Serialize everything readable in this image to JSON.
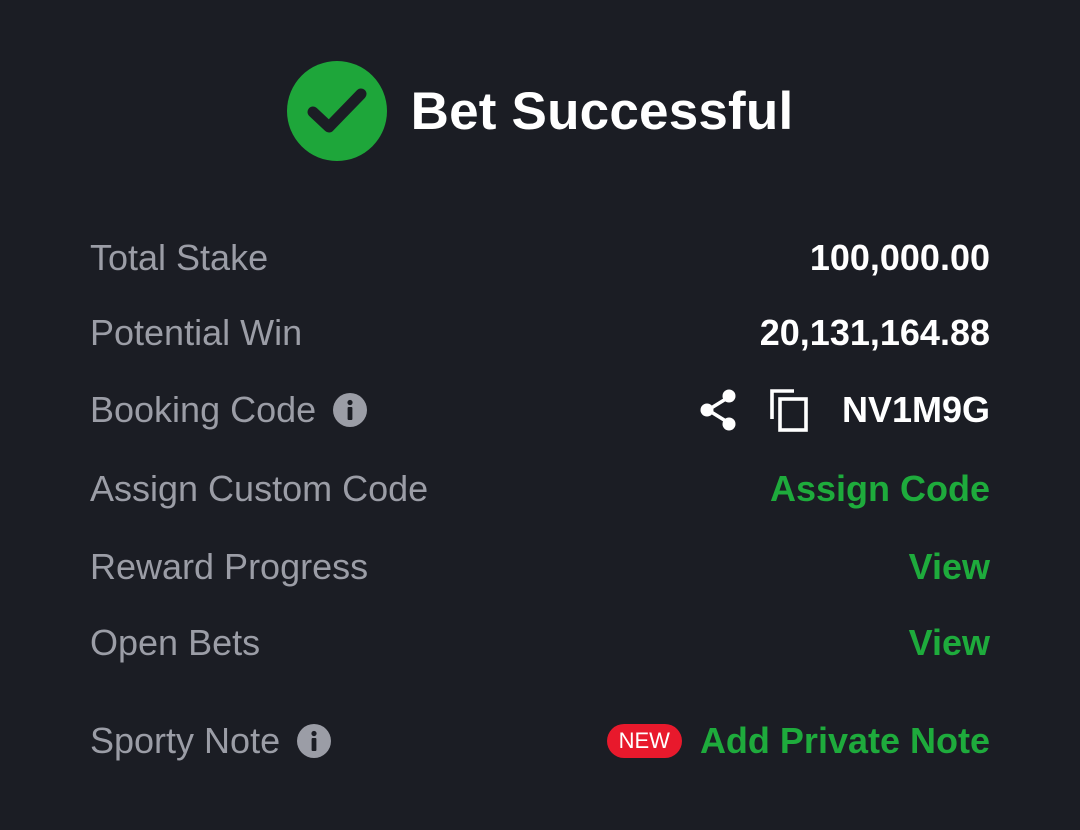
{
  "header": {
    "title": "Bet Successful"
  },
  "rows": {
    "total_stake": {
      "label": "Total Stake",
      "value": "100,000.00"
    },
    "potential_win": {
      "label": "Potential Win",
      "value": "20,131,164.88"
    },
    "booking_code": {
      "label": "Booking Code",
      "value": "NV1M9G"
    },
    "assign_custom_code": {
      "label": "Assign Custom Code",
      "action": "Assign Code"
    },
    "reward_progress": {
      "label": "Reward Progress",
      "action": "View"
    },
    "open_bets": {
      "label": "Open Bets",
      "action": "View"
    },
    "sporty_note": {
      "label": "Sporty Note",
      "badge": "NEW",
      "action": "Add Private Note"
    }
  },
  "icons": {
    "success": "check-circle-icon",
    "info": "info-icon",
    "share": "share-icon",
    "copy": "copy-icon"
  },
  "colors": {
    "background": "#1b1d24",
    "accent_green": "#1eab3c",
    "label_gray": "#9b9da6",
    "badge_red": "#e8192c",
    "text_white": "#ffffff"
  }
}
